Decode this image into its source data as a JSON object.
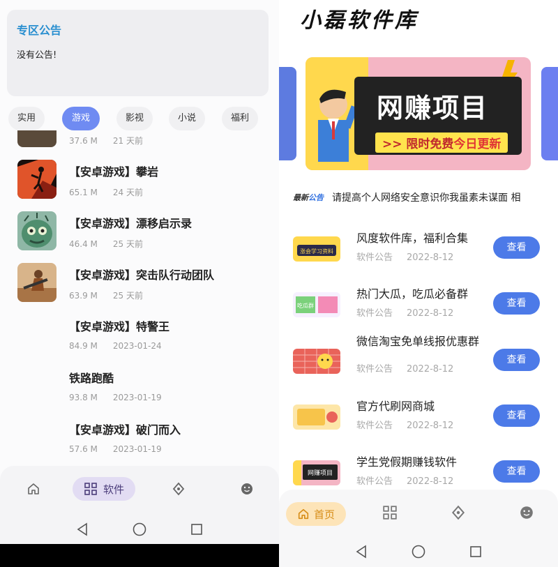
{
  "left": {
    "notice": {
      "title": "专区公告",
      "body": "没有公告!"
    },
    "categories": [
      {
        "label": "实用",
        "active": false
      },
      {
        "label": "游戏",
        "active": true
      },
      {
        "label": "影视",
        "active": false
      },
      {
        "label": "小说",
        "active": false
      },
      {
        "label": "福利",
        "active": false
      }
    ],
    "items": [
      {
        "title": "",
        "size": "37.6 M",
        "date": "21 天前"
      },
      {
        "title": "【安卓游戏】攀岩",
        "size": "65.1 M",
        "date": "24 天前"
      },
      {
        "title": "【安卓游戏】漂移启示录",
        "size": "46.4 M",
        "date": "25 天前"
      },
      {
        "title": "【安卓游戏】突击队行动团队",
        "size": "63.9 M",
        "date": "25 天前"
      },
      {
        "title": "【安卓游戏】特警王",
        "size": "84.9 M",
        "date": "2023-01-24"
      },
      {
        "title": "铁路跑酷",
        "size": "93.8 M",
        "date": "2023-01-19"
      },
      {
        "title": "【安卓游戏】破门而入",
        "size": "57.6 M",
        "date": "2023-01-19"
      }
    ],
    "nav": {
      "software_label": "软件"
    }
  },
  "right": {
    "brand": "小磊软件库",
    "banner": {
      "headline": "网赚项目",
      "tag_prefix": ">> 限时免费",
      "tag_accent": "今日更新"
    },
    "ticker": {
      "label_a": "最新",
      "label_b": "公告",
      "text": "请提高个人网络安全意识你我虽素未谋面 相"
    },
    "items": [
      {
        "title": "风度软件库，福利合集",
        "type": "软件公告",
        "date": "2022-8-12",
        "button": "查看"
      },
      {
        "title": "热门大瓜，吃瓜必备群",
        "type": "软件公告",
        "date": "2022-8-12",
        "button": "查看"
      },
      {
        "title": "微信淘宝免单线报优惠群",
        "type": "软件公告",
        "date": "2022-8-12",
        "button": "查看"
      },
      {
        "title": "官方代刷网商城",
        "type": "软件公告",
        "date": "2022-8-12",
        "button": "查看"
      },
      {
        "title": "学生党假期赚钱软件",
        "type": "软件公告",
        "date": "2022-8-12",
        "button": "查看"
      }
    ],
    "thumb_captions": [
      "涨会学习资料",
      "吃瓜群",
      "",
      "",
      "网赚项目"
    ],
    "nav": {
      "home_label": "首页"
    }
  },
  "colors": {
    "accent_blue": "#4c7ae8",
    "chip_active": "#6f8bf2",
    "notice_blue": "#2a8fd0",
    "home_pill": "#fde4b8"
  }
}
